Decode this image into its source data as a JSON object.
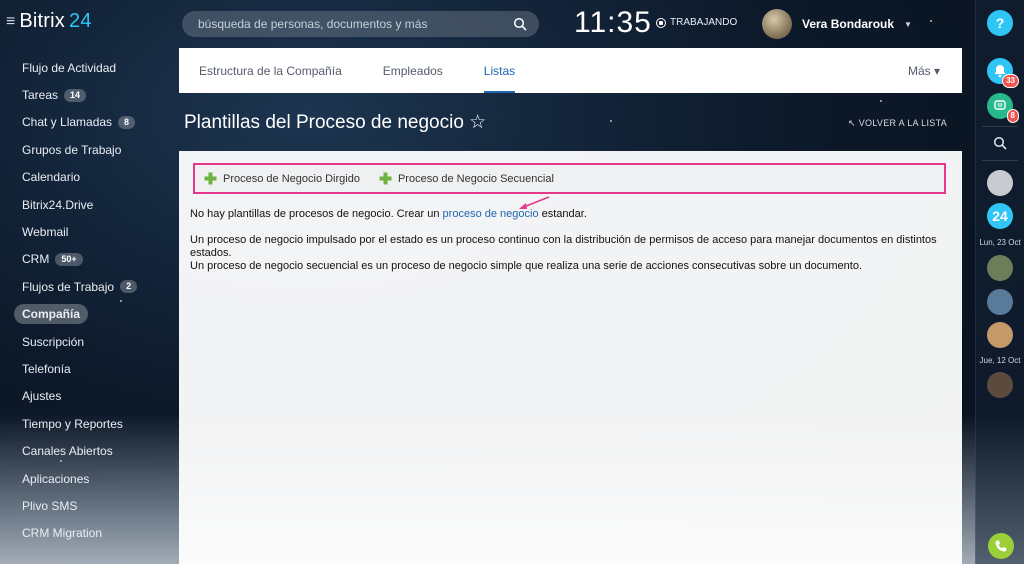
{
  "app": {
    "logo_name": "Bitrix",
    "logo_num": "24"
  },
  "search": {
    "placeholder": "búsqueda de personas, documentos y más"
  },
  "clock": {
    "time": "11:35",
    "status": "TRABAJANDO"
  },
  "user": {
    "name": "Vera Bondarouk"
  },
  "menu": {
    "items": [
      {
        "label": "Flujo de Actividad",
        "badge": ""
      },
      {
        "label": "Tareas",
        "badge": "14"
      },
      {
        "label": "Chat y Llamadas",
        "badge": "8"
      },
      {
        "label": "Grupos de Trabajo",
        "badge": ""
      },
      {
        "label": "Calendario",
        "badge": ""
      },
      {
        "label": "Bitrix24.Drive",
        "badge": ""
      },
      {
        "label": "Webmail",
        "badge": ""
      },
      {
        "label": "CRM",
        "badge": "50+"
      },
      {
        "label": "Flujos de Trabajo",
        "badge": "2"
      },
      {
        "label": "Compañía",
        "badge": "",
        "active": true
      },
      {
        "label": "Suscripción",
        "badge": ""
      },
      {
        "label": "Telefonía",
        "badge": ""
      },
      {
        "label": "Ajustes",
        "badge": ""
      },
      {
        "label": "Tiempo y Reportes",
        "badge": ""
      },
      {
        "label": "Canales Abiertos",
        "badge": ""
      },
      {
        "label": "Aplicaciones",
        "badge": ""
      },
      {
        "label": "Plivo SMS",
        "badge": ""
      },
      {
        "label": "CRM Migration",
        "badge": ""
      }
    ]
  },
  "tabs": {
    "items": [
      "Estructura de la Compañía",
      "Empleados",
      "Listas"
    ],
    "active": "Listas",
    "more": "Más"
  },
  "page": {
    "title": "Plantillas del Proceso de negocio ☆",
    "back": "VOLVER A LA LISTA"
  },
  "toolbar": {
    "btn1": "Proceso de Negocio Dirgido",
    "btn2": "Proceso de Negocio Secuencial"
  },
  "content": {
    "line1_before": "No hay plantillas de procesos de negocio. Crear un",
    "line1_link": "proceso de negocio",
    "line1_after": "estandar.",
    "para2": "Un proceso de negocio impulsado por el estado es un proceso continuo con la distribución de permisos de acceso para manejar documentos en distintos estados.",
    "para3": "Un proceso de negocio secuencial es un proceso de negocio simple que realiza una serie de acciones consecutivas sobre un documento."
  },
  "rail": {
    "help": "?",
    "bell_badge": "33",
    "chat_badge": "8",
    "b24": "24",
    "date1": "Lun, 23 Oct",
    "date2": "Jue, 12 Oct"
  },
  "colors": {
    "accent": "#2fc6f6",
    "link": "#2067b0",
    "highlight": "#e4388a",
    "phone": "#9bcf3a"
  }
}
